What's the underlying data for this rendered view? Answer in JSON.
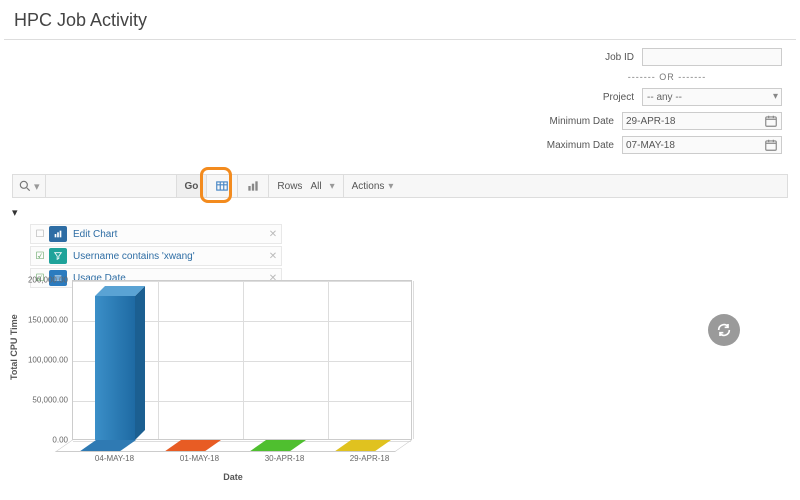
{
  "title": "HPC Job Activity",
  "filters": {
    "job_id_label": "Job ID",
    "job_id_value": "",
    "or_text": "------- OR -------",
    "project_label": "Project",
    "project_value": "-- any --",
    "min_date_label": "Minimum Date",
    "min_date_value": "29-APR-18",
    "max_date_label": "Maximum Date",
    "max_date_value": "07-MAY-18"
  },
  "toolbar": {
    "go_label": "Go",
    "rows_label": "Rows",
    "rows_value": "All",
    "actions_label": "Actions"
  },
  "applied_filters": {
    "f1_text": "Edit Chart",
    "f2_text": "Username contains 'xwang'",
    "f3_text": "Usage Date"
  },
  "refresh_title": "Refresh",
  "chart_data": {
    "type": "bar",
    "title": "",
    "xlabel": "Date",
    "ylabel": "Total CPU Time",
    "categories": [
      "04-MAY-18",
      "01-MAY-18",
      "30-APR-18",
      "29-APR-18"
    ],
    "values": [
      180000,
      0,
      0,
      0
    ],
    "colors": [
      "#2f7ab3",
      "#e85c24",
      "#4fbf2f",
      "#e0c21f"
    ],
    "ylim": [
      0,
      200000
    ],
    "yticks": [
      0,
      50000,
      100000,
      150000,
      200000
    ],
    "ytick_labels": [
      "0.00",
      "50,000.00",
      "100,000.00",
      "150,000.00",
      "200,000.00"
    ]
  }
}
